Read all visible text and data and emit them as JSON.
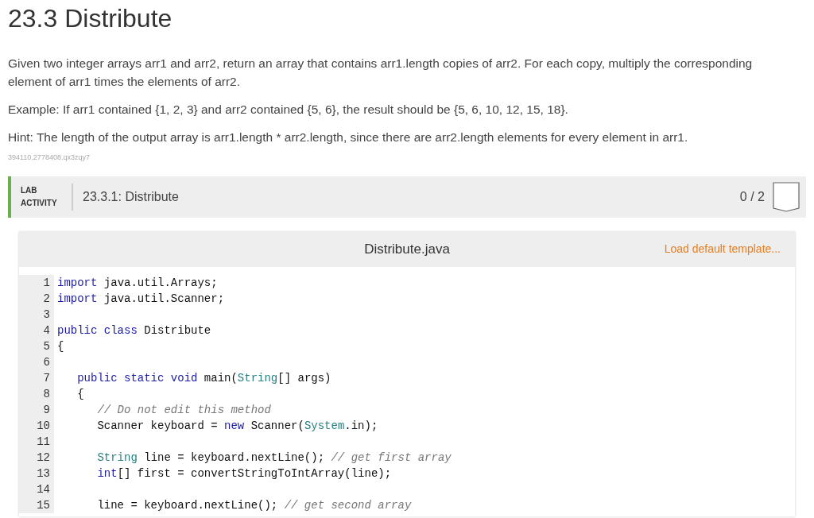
{
  "title": "23.3 Distribute",
  "paragraphs": [
    "Given two integer arrays arr1 and arr2, return an array that contains arr1.length copies of arr2. For each copy, multiply the corresponding element of arr1 times the elements of arr2.",
    "Example: If arr1 contained {1, 2, 3} and arr2 contained {5, 6}, the result should be {5, 6, 10, 12, 15, 18}.",
    "Hint: The length of the output array is arr1.length * arr2.length, since there are arr2.length elements for every element in arr1."
  ],
  "id_text": "394110.2778408.qx3zqy7",
  "lab": {
    "tag_line1": "LAB",
    "tag_line2": "ACTIVITY",
    "name": "23.3.1: Distribute",
    "score": "0 / 2"
  },
  "editor": {
    "filename": "Distribute.java",
    "template_link": "Load default template...",
    "lines": [
      {
        "number": "1",
        "tokens": [
          {
            "kind": "keyword",
            "text": "import"
          },
          {
            "kind": "plain",
            "text": " java.util.Arrays;"
          }
        ]
      },
      {
        "number": "2",
        "tokens": [
          {
            "kind": "keyword",
            "text": "import"
          },
          {
            "kind": "plain",
            "text": " java.util.Scanner;"
          }
        ]
      },
      {
        "number": "3"
      },
      {
        "number": "4",
        "tokens": [
          {
            "kind": "keyword",
            "text": "public class"
          },
          {
            "kind": "plain",
            "text": " Distribute"
          }
        ]
      },
      {
        "number": "5",
        "tokens": [
          {
            "kind": "plain",
            "text": "{"
          }
        ]
      },
      {
        "number": "6"
      },
      {
        "number": "7",
        "tokens": [
          {
            "kind": "keyword",
            "text": "   public static void"
          },
          {
            "kind": "plain",
            "text": " main("
          },
          {
            "kind": "type",
            "text": "String"
          },
          {
            "kind": "plain",
            "text": "[] args)"
          }
        ]
      },
      {
        "number": "8",
        "tokens": [
          {
            "kind": "plain",
            "text": "   {"
          }
        ]
      },
      {
        "number": "9",
        "tokens": [
          {
            "kind": "comment",
            "text": "      // Do not edit this method"
          }
        ]
      },
      {
        "number": "10",
        "tokens": [
          {
            "kind": "plain",
            "text": "      Scanner keyboard = "
          },
          {
            "kind": "keyword",
            "text": "new"
          },
          {
            "kind": "plain",
            "text": " Scanner("
          },
          {
            "kind": "type",
            "text": "System"
          },
          {
            "kind": "plain",
            "text": ".in);"
          }
        ]
      },
      {
        "number": "11"
      },
      {
        "number": "12",
        "tokens": [
          {
            "kind": "type",
            "text": "      String"
          },
          {
            "kind": "plain",
            "text": " line = keyboard.nextLine(); "
          },
          {
            "kind": "comment",
            "text": "// get first array"
          }
        ]
      },
      {
        "number": "13",
        "tokens": [
          {
            "kind": "keyword",
            "text": "      int"
          },
          {
            "kind": "plain",
            "text": "[] first = convertStringToIntArray(line);"
          }
        ]
      },
      {
        "number": "14"
      },
      {
        "number": "15",
        "tokens": [
          {
            "kind": "plain",
            "text": "      line = keyboard.nextLine(); "
          },
          {
            "kind": "comment",
            "text": "// get second array"
          }
        ]
      }
    ]
  }
}
